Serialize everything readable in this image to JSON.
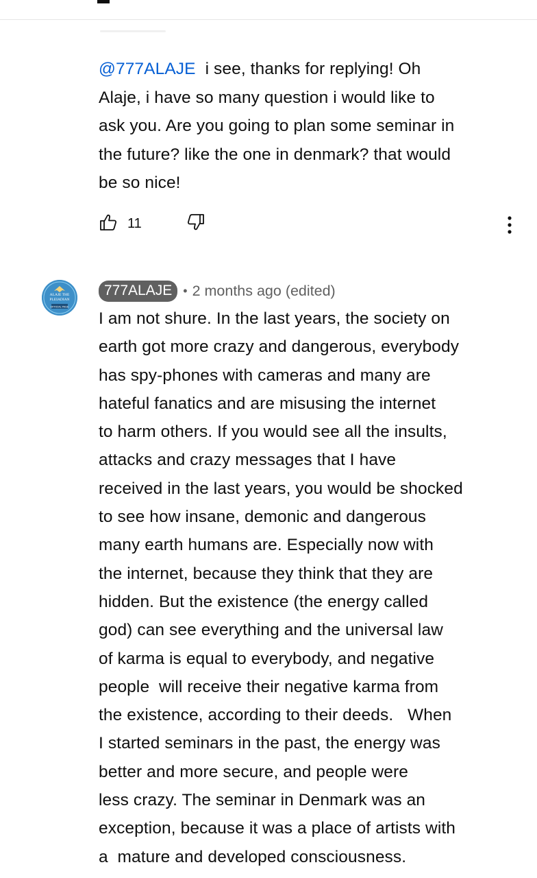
{
  "reply_comment": {
    "mention": "@777ALAJE",
    "text_lines": [
      "i see, thanks for replying! Oh",
      "Alaje, i have so many question i would like to",
      "ask you. Are you going to plan some seminar in",
      "the future? like the one in denmark? that would",
      "be so nice!"
    ],
    "like_count": "11",
    "icons": {
      "like": "thumb-up-icon",
      "dislike": "thumb-down-icon",
      "menu": "more-vert-icon"
    }
  },
  "author_comment": {
    "avatar_text": [
      "ALAJE THE",
      "PLEIADIAN",
      "OFFICIAL PAGE"
    ],
    "handle": "777ALAJE",
    "separator": "•",
    "meta": "2 months ago (edited)",
    "body_lines": [
      "I am not shure. In the last years, the society on",
      "earth got more crazy and dangerous, everybody",
      "has spy-phones with cameras and many are",
      "hateful fanatics and are misusing the internet",
      "to harm others. If you would see all the insults,",
      "attacks and crazy messages that I have",
      "received in the last years, you would be shocked",
      "to see how insane, demonic and dangerous",
      "many earth humans are. Especially now with",
      "the internet, because they think that they are",
      "hidden. But the existence (the energy called",
      "god) can see everything and the universal law",
      "of karma is equal to everybody, and negative",
      "people  will receive their negative karma from",
      "the existence, according to their deeds.   When",
      "I started seminars in the past, the energy was",
      "better and more secure, and people were",
      "less crazy. The seminar in Denmark was an",
      "exception, because it was a place of artists with",
      "a  mature and developed consciousness."
    ]
  },
  "colors": {
    "text": "#0f0f0f",
    "secondary": "#606060",
    "mention": "#065fd4",
    "chip_bg": "#606060",
    "avatar_bg": "#3d8fc8"
  }
}
